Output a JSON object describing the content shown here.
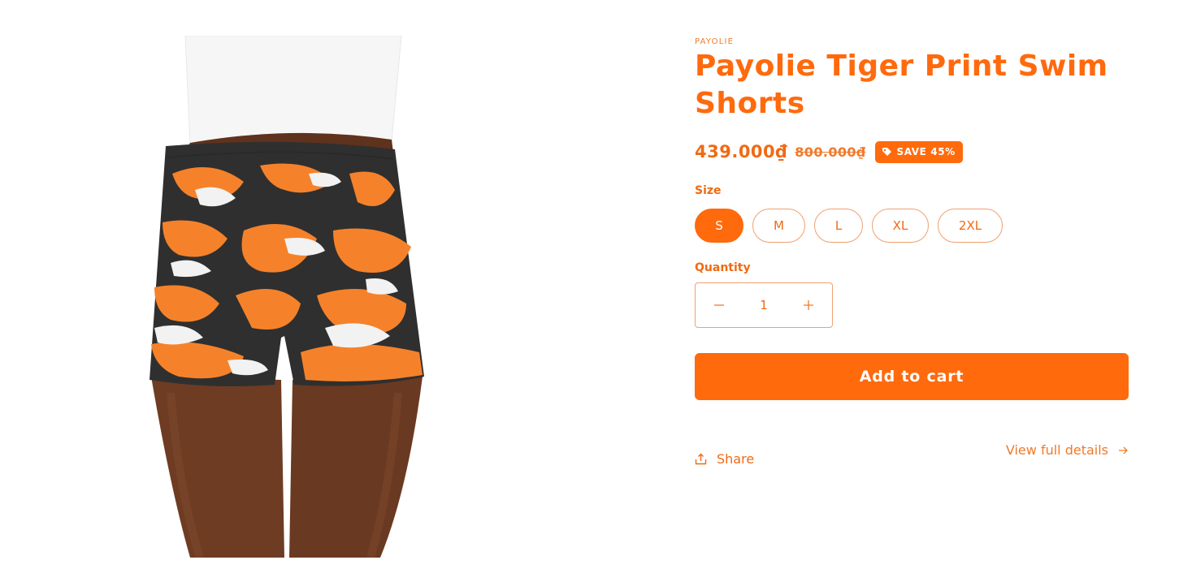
{
  "product": {
    "vendor": "PAYOLIE",
    "title": "Payolie Tiger Print Swim Shorts",
    "price": "439.000₫",
    "compare_price": "800.000₫",
    "badge": "SAVE 45%"
  },
  "size": {
    "label": "Size",
    "options": [
      "S",
      "M",
      "L",
      "XL",
      "2XL"
    ],
    "selected": "S"
  },
  "quantity": {
    "label": "Quantity",
    "value": "1"
  },
  "actions": {
    "add_to_cart": "Add to cart",
    "share": "Share",
    "view_details": "View full details"
  },
  "colors": {
    "accent": "#ff6a0d",
    "camo_orange": "#f5822a",
    "camo_dark": "#2f2f2f",
    "skin": "#6b3a22",
    "top": "#f7f7f7"
  },
  "icons": {
    "tag": "tag-icon",
    "share": "share-icon",
    "arrow": "arrow-right-icon",
    "minus": "minus-icon",
    "plus": "plus-icon"
  }
}
